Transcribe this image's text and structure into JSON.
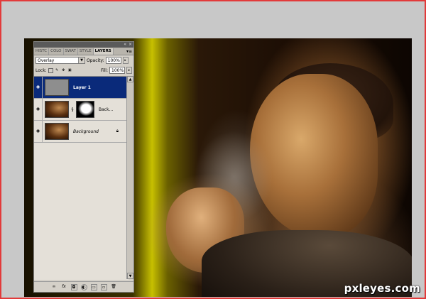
{
  "panel": {
    "tabs": [
      "HISTC",
      "COLO",
      "SWAT",
      "STYLE",
      "LAYERS"
    ],
    "active_tab": "LAYERS",
    "blend_mode": "Overlay",
    "opacity_label": "Opacity:",
    "opacity_value": "100%",
    "lock_label": "Lock:",
    "fill_label": "Fill:",
    "fill_value": "100%",
    "layers": [
      {
        "name": "Layer 1",
        "selected": true
      },
      {
        "name": "Back...",
        "selected": false
      },
      {
        "name": "Background",
        "selected": false
      }
    ]
  },
  "watermark": "pxleyes.com",
  "colors": {
    "selected_layer": "#0a2a7a",
    "frame_border": "#e23a3a",
    "panel_bg": "#d4d0c8"
  }
}
